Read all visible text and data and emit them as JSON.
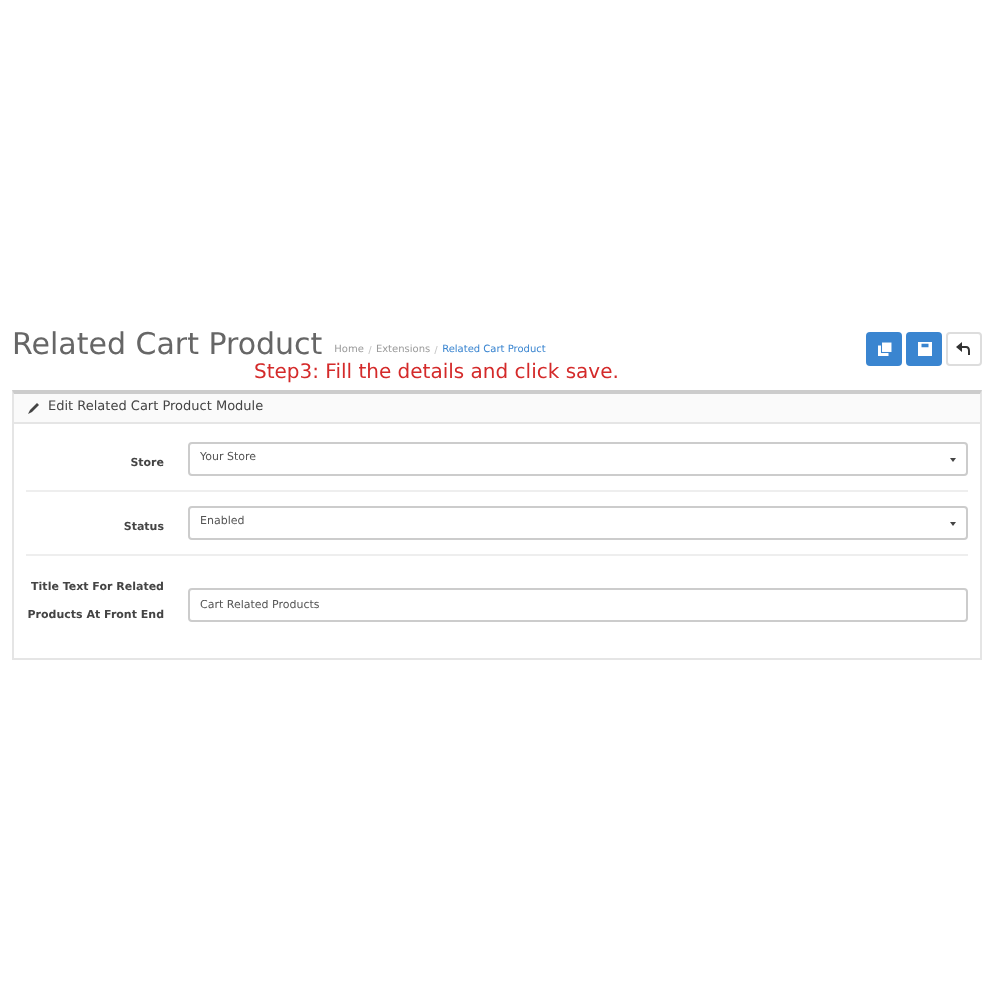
{
  "page_title": "Related Cart Product",
  "breadcrumb": [
    {
      "label": "Home",
      "selected": false
    },
    {
      "label": "Extensions",
      "selected": false
    },
    {
      "label": "Related Cart Product",
      "selected": true
    }
  ],
  "toolbar": [
    {
      "kind": "primary"
    },
    {
      "kind": "primary"
    },
    {
      "kind": "default"
    }
  ],
  "instruction": "Step3: Fill the details and click save.",
  "panel": {
    "heading": "Edit Related Cart Product Module",
    "fields": [
      {
        "label": "Store",
        "kind": "select",
        "value": "Your Store"
      },
      {
        "label": "Status",
        "kind": "select",
        "value": "Enabled"
      },
      {
        "label": "Title Text For Related Products At Front End",
        "kind": "text",
        "value": "Cart Related Products"
      }
    ]
  }
}
